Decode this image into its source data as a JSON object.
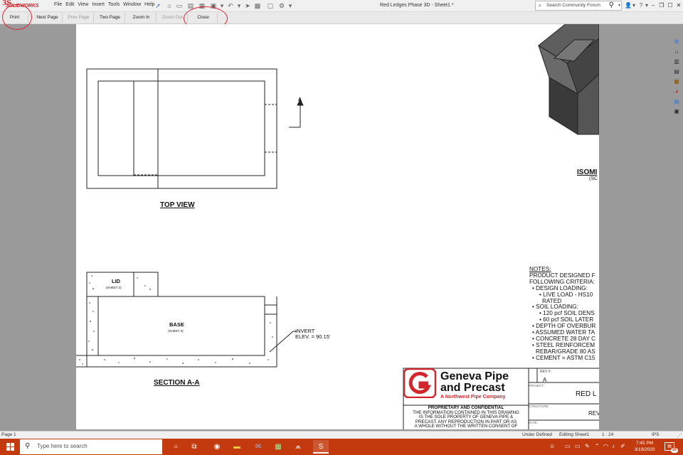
{
  "app": {
    "brand_mark": "3S",
    "brand_word": "SOLIDWORKS",
    "document_title": "Red Ledges Phase 3D - Sheet1 *",
    "menus": [
      "File",
      "Edit",
      "View",
      "Insert",
      "Tools",
      "Window",
      "Help"
    ],
    "search_placeholder": "Search Community Forum"
  },
  "toolbar": {
    "print": "Print",
    "next_page": "Next Page",
    "prev_page": "Prev Page",
    "two_page": "Two Page",
    "zoom_in": "Zoom In",
    "zoom_out": "Zoom Out",
    "close": "Close"
  },
  "drawing": {
    "top_view_label": "TOP VIEW",
    "section_label": "SECTION A-A",
    "section_marker": "A",
    "lid_label": "LID",
    "lid_sub": "(SHEET 2)",
    "base_label": "BASE",
    "base_sub": "(SHEET 3)",
    "invert_line1": "INVERT",
    "invert_line2": "ELEV. = 90.15'",
    "isometric_label": "ISOMI",
    "isometric_sub": "(SC",
    "notes": {
      "title": "NOTES:",
      "lines": [
        {
          "t": "PRODUCT DESIGNED F",
          "lvl": 0
        },
        {
          "t": "FOLLOWING CRITERIA:",
          "lvl": 0
        },
        {
          "t": "• DESIGN LOADING:",
          "lvl": 1
        },
        {
          "t": "• LIVE LOAD - HS10",
          "lvl": 2
        },
        {
          "t": "RATED",
          "lvl": 3
        },
        {
          "t": "• SOIL LOADING:",
          "lvl": 1
        },
        {
          "t": "• 120 pcf SOIL DENS",
          "lvl": 2
        },
        {
          "t": "• 60 pcf SOIL LATER",
          "lvl": 2
        },
        {
          "t": "• DEPTH OF OVERBUR",
          "lvl": 1
        },
        {
          "t": "• ASSUMED WATER TA",
          "lvl": 1
        },
        {
          "t": "• CONCRETE 28 DAY C",
          "lvl": 1
        },
        {
          "t": "• STEEL REINFORCEM",
          "lvl": 1
        },
        {
          "t": "REBAR/GRADE 80 AS",
          "lvl": 3
        },
        {
          "t": "• CEMENT = ASTM C15",
          "lvl": 1
        }
      ]
    },
    "title_block": {
      "brand_line1": "Geneva Pipe",
      "brand_line2": "and Precast",
      "brand_line3": "A Northwest Pipe Company",
      "proprietary": [
        "PROPRIETARY AND CONFIDENTIAL",
        "THE INFORMATION CONTAINED IN THIS DRAWING",
        "IS THE SOLE PROPERTY OF GENEVA PIPE &",
        "PRECAST. ANY REPRODUCTION IN PART OR AS",
        "A WHOLE WITHOUT THE WRITTEN CONSENT OF"
      ],
      "rev_label": "REV #:",
      "rev_value": "A",
      "project_label": "PROJECT:",
      "project_value": "RED L",
      "structure_label": "STRUCTURE:",
      "structure_value": "REV",
      "date_label": "DATE:"
    }
  },
  "status": {
    "page": "Page 1",
    "under_defined": "Under Defined",
    "editing": "Editing Sheet1",
    "scale": "1 : 24",
    "units": "IPS"
  },
  "taskbar": {
    "search_placeholder": "Type here to search",
    "time": "7:45 PM",
    "date": "3/19/2020",
    "notifications": "20"
  },
  "colors": {
    "taskbar": "#c33a0e",
    "brand_red": "#d2262c",
    "annotation_red": "#e0242e"
  }
}
